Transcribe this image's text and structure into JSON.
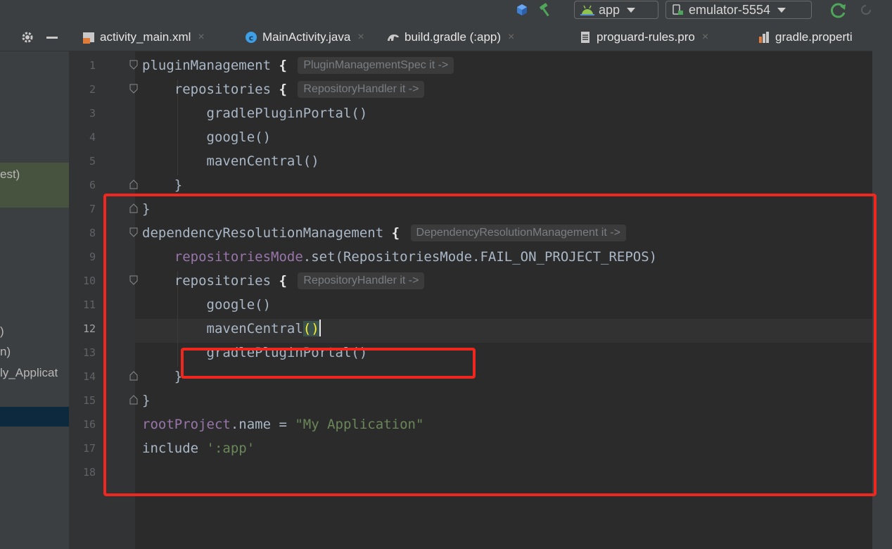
{
  "toolbar": {
    "app_config": "app",
    "device": "emulator-5554"
  },
  "tabs": [
    {
      "label": "activity_main.xml"
    },
    {
      "label": "MainActivity.java"
    },
    {
      "label": "build.gradle (:app)"
    },
    {
      "label": "proguard-rules.pro"
    },
    {
      "label": "gradle.properti"
    }
  ],
  "tab_close": "×",
  "project_tree": [
    {
      "label": "est)"
    },
    {
      "label": ")"
    },
    {
      "label": "n)"
    },
    {
      "label": "ly_Applicat"
    }
  ],
  "editor": {
    "line_numbers": [
      "1",
      "2",
      "3",
      "4",
      "5",
      "6",
      "7",
      "8",
      "9",
      "10",
      "11",
      "12",
      "13",
      "14",
      "15",
      "16",
      "17",
      "18"
    ],
    "current_line": "12",
    "code": {
      "l1_text": "pluginManagement ",
      "brace_open": "{",
      "brace_close": "}",
      "l1_hint": "PluginManagementSpec it ->",
      "l2_text": "repositories ",
      "l2_hint": "RepositoryHandler it ->",
      "l3_text": "gradlePluginPortal()",
      "l4_text": "google()",
      "l5_text": "mavenCentral()",
      "l8_text": "dependencyResolutionManagement ",
      "l8_hint": "DependencyResolutionManagement it ->",
      "l9_prop": "repositoriesMode",
      "l9_text": ".set(RepositoriesMode.FAIL_ON_PROJECT_REPOS)",
      "l10_text": "repositories ",
      "l10_hint": "RepositoryHandler it ->",
      "l11_text": "google()",
      "l12_text": "mavenCentral",
      "l12_paren": "()",
      "l13_text": "gradlePluginPortal()",
      "l16_prop": "rootProject",
      "l16_text": ".name = ",
      "l16_str": "\"My Application\"",
      "l17_text": "include ",
      "l17_str": "':app'"
    }
  },
  "colors": {
    "annotation_red": "#f0271e",
    "editor_bg": "#2b2b2b",
    "string": "#6a8759",
    "property": "#9876aa"
  }
}
